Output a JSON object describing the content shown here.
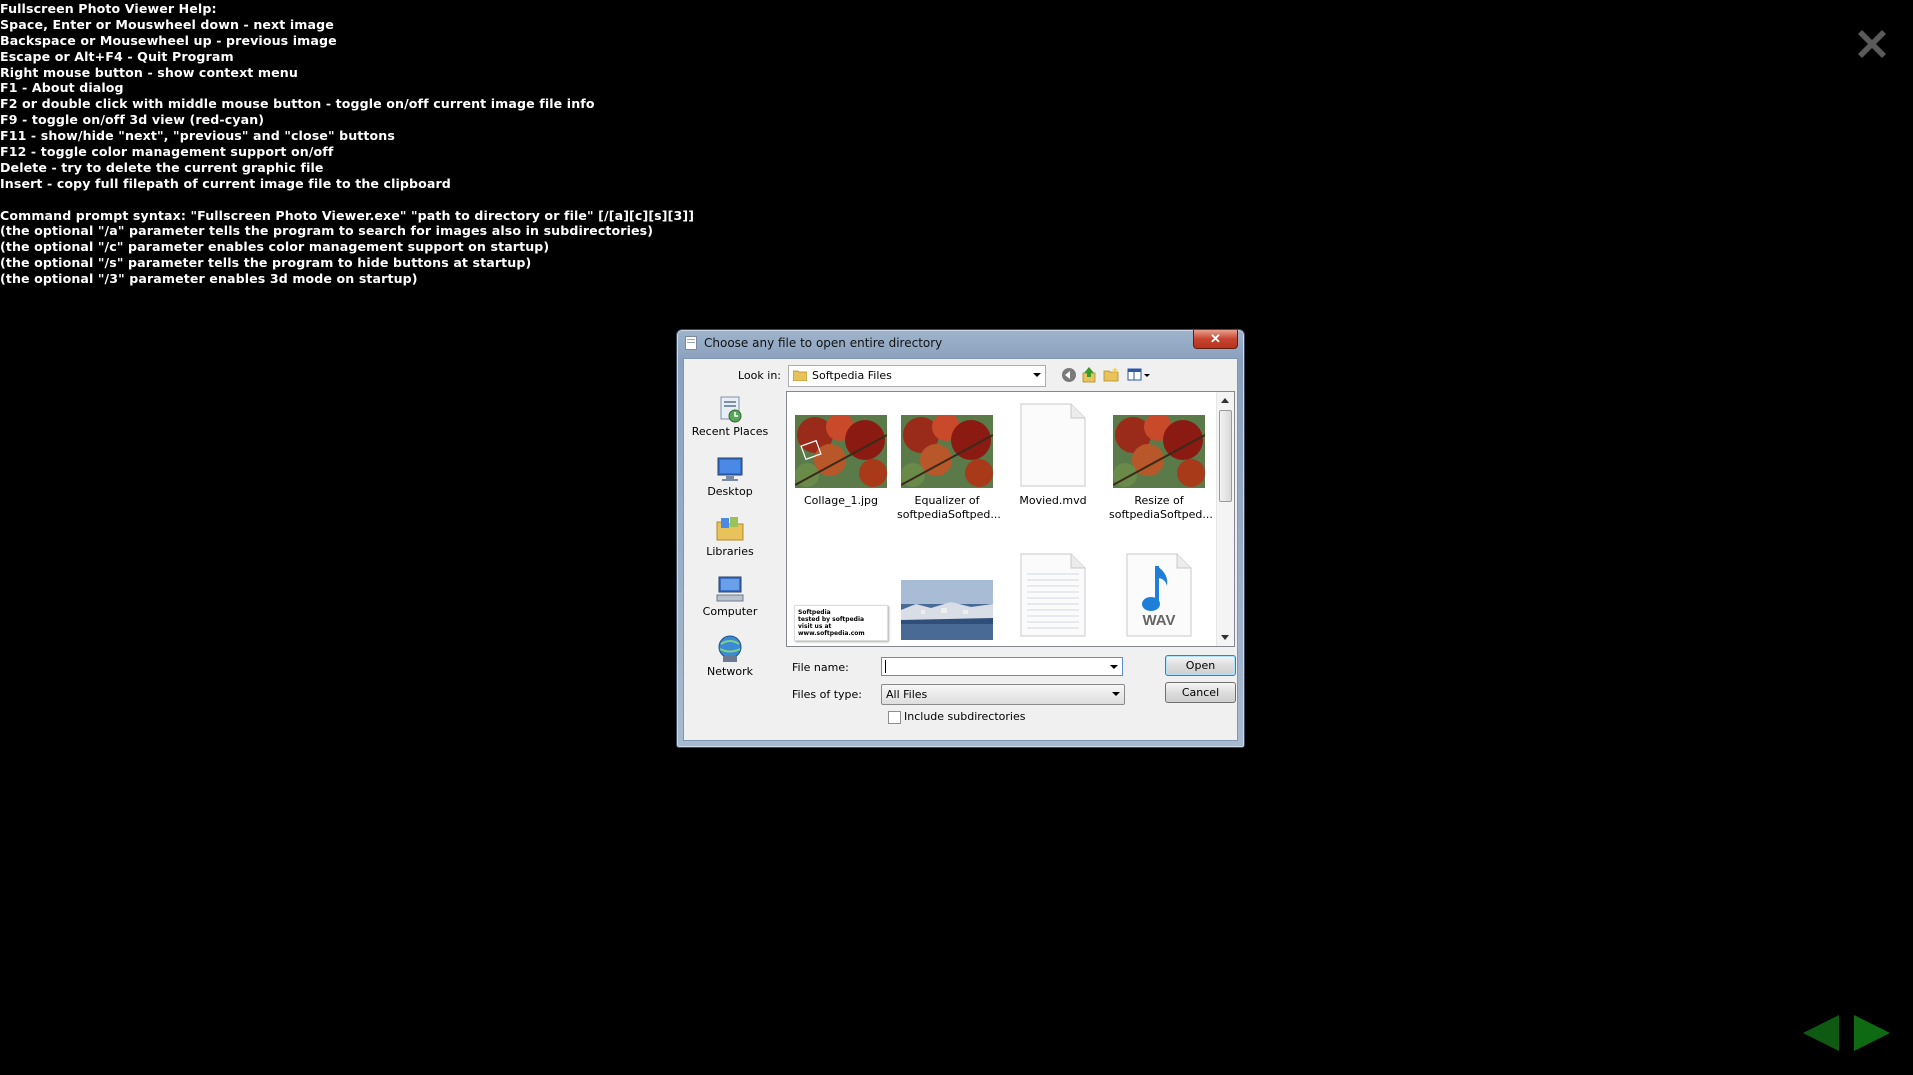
{
  "help_lines": [
    "Fullscreen Photo Viewer Help:",
    "Space, Enter or Mouswheel down - next image",
    "Backspace or Mousewheel up - previous image",
    "Escape or Alt+F4 - Quit Program",
    "Right mouse button - show context menu",
    "F1 - About dialog",
    "F2 or double click with middle mouse button - toggle on/off current image file info",
    "F9 - toggle on/off 3d view (red-cyan)",
    "F11 - show/hide \"next\", \"previous\" and \"close\" buttons",
    "F12 - toggle color management support on/off",
    "Delete - try to delete the current graphic file",
    "Insert - copy full filepath of current image file to the clipboard",
    "",
    "Command prompt syntax: \"Fullscreen Photo Viewer.exe\" \"path to directory or file\" [/[a][c][s][3]]",
    "(the optional \"/a\" parameter tells the program to search for images also in subdirectories)",
    "(the optional \"/c\" parameter enables color management support on startup)",
    "(the optional \"/s\" parameter tells the program to hide buttons at startup)",
    "(the optional \"/3\" parameter enables 3d mode on startup)"
  ],
  "dialog": {
    "title": "Choose any file to open entire directory",
    "close_glyph": "✕",
    "look_in_label": "Look in:",
    "look_in_value": "Softpedia Files",
    "places": [
      {
        "label": "Recent Places"
      },
      {
        "label": "Desktop"
      },
      {
        "label": "Libraries"
      },
      {
        "label": "Computer"
      },
      {
        "label": "Network"
      }
    ],
    "files": [
      {
        "line1": "Collage_1.jpg",
        "line2": ""
      },
      {
        "line1": "Equalizer of",
        "line2": "softpediaSoftped..."
      },
      {
        "line1": "Movied.mvd",
        "line2": ""
      },
      {
        "line1": "Resize of",
        "line2": "softpediaSoftped..."
      },
      {
        "line1": "",
        "line2": ""
      },
      {
        "line1": "",
        "line2": ""
      },
      {
        "line1": "",
        "line2": ""
      },
      {
        "line1": "",
        "line2": ""
      }
    ],
    "softpedia_thumb_text": [
      "Softpedia",
      "tested by softpedia",
      "visit us at www.softpedia.com"
    ],
    "wav_label": "WAV",
    "file_name_label": "File name:",
    "file_name_value": "",
    "files_of_type_label": "Files of type:",
    "files_of_type_value": "All Files",
    "include_subdirectories_label": "Include subdirectories",
    "open_label": "Open",
    "cancel_label": "Cancel"
  },
  "colors": {
    "background": "#000000",
    "help_text": "#ffffff",
    "nav_arrows": "#0f5a12",
    "close_x": "#5a5a5a"
  }
}
